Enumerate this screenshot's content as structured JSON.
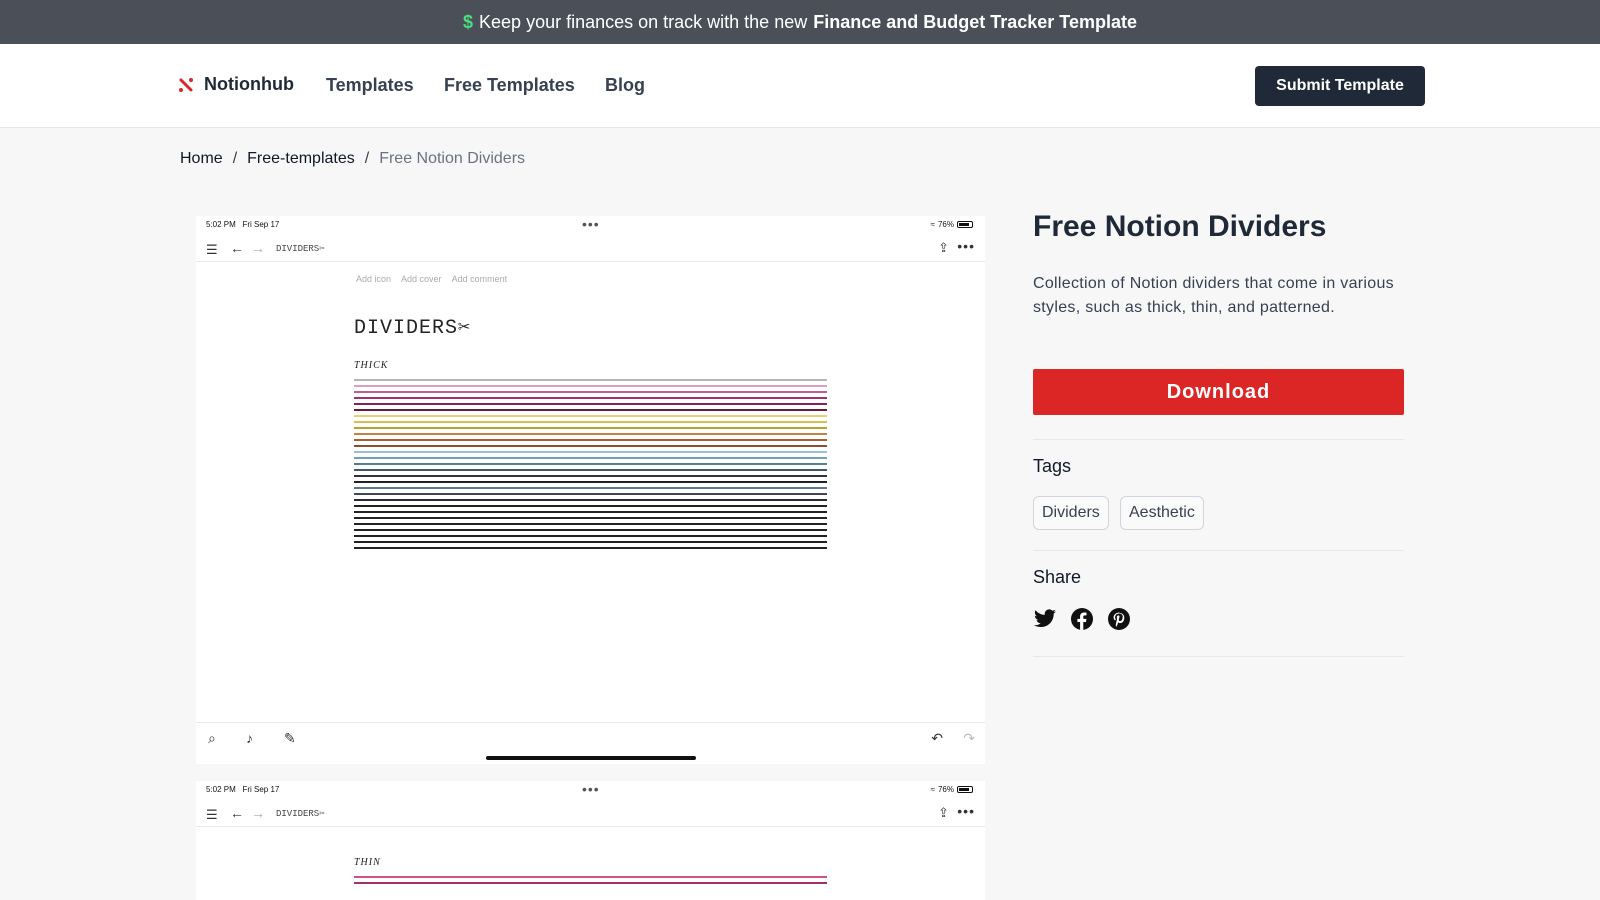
{
  "banner": {
    "icon": "dollar-icon",
    "prefix": "Keep your finances on track with the new",
    "highlight": "Finance and Budget Tracker Template"
  },
  "nav": {
    "logo_text": "Notionhub",
    "links": [
      "Templates",
      "Free Templates",
      "Blog"
    ],
    "submit_label": "Submit Template"
  },
  "breadcrumb": {
    "items": [
      "Home",
      "Free-templates",
      "Free Notion Dividers"
    ],
    "separator": "/"
  },
  "preview": {
    "status_time": "5:02 PM",
    "status_date": "Fri Sep 17",
    "battery": "76%",
    "page_name": "DIVIDERS✂",
    "page_actions": [
      "Add icon",
      "Add cover",
      "Add comment"
    ],
    "doc_title": "DIVIDERS✂",
    "section_thick": "THICK",
    "section_thin": "THIN",
    "thick_colors": [
      "#b5b5b5",
      "#d9a0c0",
      "#c05a9a",
      "#a0306e",
      "#8a2050",
      "#6b1a3c",
      "#e6d070",
      "#d8c050",
      "#c0a030",
      "#c88040",
      "#a86030",
      "#8a5030",
      "#9ac0d8",
      "#70a0b8",
      "#508090",
      "#405868",
      "#303040",
      "#202028",
      "#5a7890",
      "#404858",
      "#2a2a35",
      "#222",
      "#222",
      "#222",
      "#222",
      "#222",
      "#222",
      "#222",
      "#222"
    ],
    "thin_colors": [
      "#d05090",
      "#a0306e"
    ]
  },
  "product": {
    "title": "Free Notion Dividers",
    "description": "Collection of Notion dividers that come in various styles, such as thick, thin, and patterned.",
    "download_label": "Download",
    "tags_label": "Tags",
    "tags": [
      "Dividers",
      "Aesthetic"
    ],
    "share_label": "Share",
    "share_icons": [
      "twitter-icon",
      "facebook-icon",
      "pinterest-icon"
    ]
  }
}
